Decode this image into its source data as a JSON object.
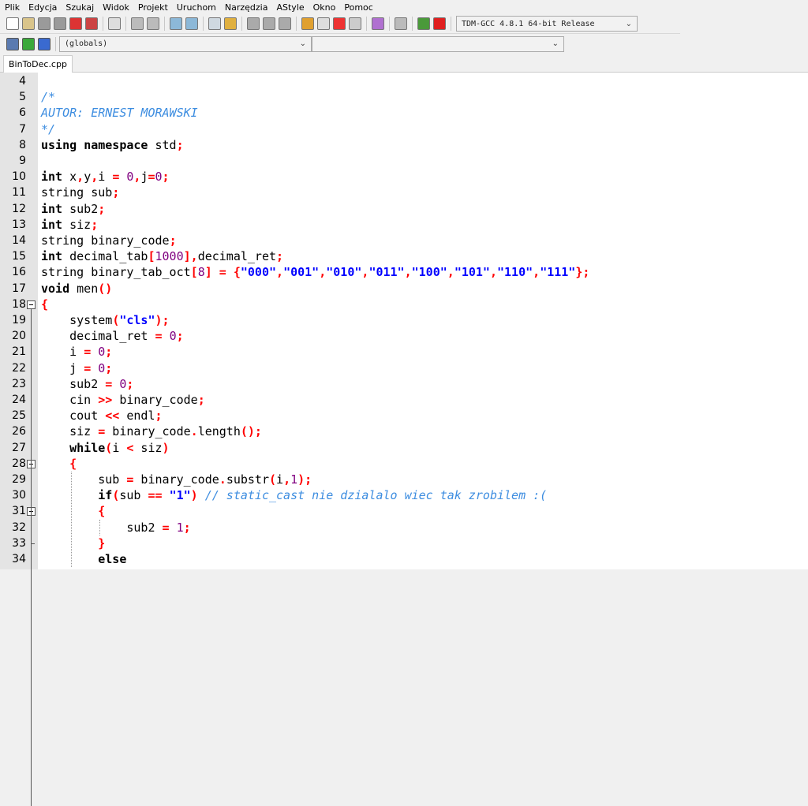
{
  "menu": [
    "Plik",
    "Edycja",
    "Szukaj",
    "Widok",
    "Projekt",
    "Uruchom",
    "Narzędzia",
    "AStyle",
    "Okno",
    "Pomoc"
  ],
  "toolbar1": {
    "icons": [
      "new-file-icon",
      "open-file-icon",
      "save-icon",
      "save-all-icon",
      "close-icon",
      "close-all-icon",
      "print-icon",
      "undo-icon",
      "redo-icon",
      "find-icon",
      "replace-icon",
      "goto-line-icon",
      "bookmark-icon",
      "indent-icon",
      "unindent-icon",
      "toggle-comment-icon",
      "compile-icon",
      "run-icon",
      "compile-run-icon",
      "rebuild-icon",
      "syntax-check-icon",
      "stop-icon",
      "profile-icon",
      "delete-profile-icon"
    ],
    "compiler_select": "TDM-GCC 4.8.1 64-bit Release"
  },
  "toolbar2": {
    "icons": [
      "new-project-icon",
      "add-file-icon",
      "remove-file-icon"
    ],
    "scope_select": "(globals)",
    "member_select": ""
  },
  "tabs": [
    {
      "label": "BinToDec.cpp",
      "active": true
    }
  ],
  "colors": {
    "keyword": "#000000",
    "symbol": "#ff0000",
    "number": "#800080",
    "string": "#0000ff",
    "comment": "#3d8de0",
    "gutter": "#e4e4e4"
  },
  "editor": {
    "lines": [
      {
        "n": "4",
        "t": []
      },
      {
        "n": "5",
        "t": [
          [
            "c",
            "/*"
          ]
        ]
      },
      {
        "n": "6",
        "t": [
          [
            "c",
            "AUTOR: ERNEST MORAWSKI"
          ]
        ]
      },
      {
        "n": "7",
        "t": [
          [
            "c",
            "*/"
          ]
        ]
      },
      {
        "n": "8",
        "t": [
          [
            "k",
            "using"
          ],
          [
            "i",
            " "
          ],
          [
            "k",
            "namespace"
          ],
          [
            "i",
            " std"
          ],
          [
            "s",
            ";"
          ]
        ]
      },
      {
        "n": "9",
        "t": []
      },
      {
        "n": "10",
        "t": [
          [
            "k",
            "int"
          ],
          [
            "i",
            " x"
          ],
          [
            "s",
            ","
          ],
          [
            "i",
            "y"
          ],
          [
            "s",
            ","
          ],
          [
            "i",
            "i "
          ],
          [
            "s",
            "="
          ],
          [
            "i",
            " "
          ],
          [
            "n",
            "0"
          ],
          [
            "s",
            ","
          ],
          [
            "i",
            "j"
          ],
          [
            "s",
            "="
          ],
          [
            "n",
            "0"
          ],
          [
            "s",
            ";"
          ]
        ]
      },
      {
        "n": "11",
        "t": [
          [
            "i",
            "string sub"
          ],
          [
            "s",
            ";"
          ]
        ]
      },
      {
        "n": "12",
        "t": [
          [
            "k",
            "int"
          ],
          [
            "i",
            " sub2"
          ],
          [
            "s",
            ";"
          ]
        ]
      },
      {
        "n": "13",
        "t": [
          [
            "k",
            "int"
          ],
          [
            "i",
            " siz"
          ],
          [
            "s",
            ";"
          ]
        ]
      },
      {
        "n": "14",
        "t": [
          [
            "i",
            "string binary_code"
          ],
          [
            "s",
            ";"
          ]
        ]
      },
      {
        "n": "15",
        "t": [
          [
            "k",
            "int"
          ],
          [
            "i",
            " decimal_tab"
          ],
          [
            "s",
            "["
          ],
          [
            "n",
            "1000"
          ],
          [
            "s",
            "],"
          ],
          [
            "i",
            "decimal_ret"
          ],
          [
            "s",
            ";"
          ]
        ]
      },
      {
        "n": "16",
        "t": [
          [
            "i",
            "string binary_tab_oct"
          ],
          [
            "s",
            "["
          ],
          [
            "n",
            "8"
          ],
          [
            "s",
            "] = {"
          ],
          [
            "str",
            "\"000\""
          ],
          [
            "s",
            ","
          ],
          [
            "str",
            "\"001\""
          ],
          [
            "s",
            ","
          ],
          [
            "str",
            "\"010\""
          ],
          [
            "s",
            ","
          ],
          [
            "str",
            "\"011\""
          ],
          [
            "s",
            ","
          ],
          [
            "str",
            "\"100\""
          ],
          [
            "s",
            ","
          ],
          [
            "str",
            "\"101\""
          ],
          [
            "s",
            ","
          ],
          [
            "str",
            "\"110\""
          ],
          [
            "s",
            ","
          ],
          [
            "str",
            "\"111\""
          ],
          [
            "s",
            "};"
          ]
        ]
      },
      {
        "n": "17",
        "t": [
          [
            "k",
            "void"
          ],
          [
            "i",
            " men"
          ],
          [
            "s",
            "()"
          ]
        ]
      },
      {
        "n": "18",
        "t": [
          [
            "s",
            "{"
          ]
        ]
      },
      {
        "n": "19",
        "t": [
          [
            "i",
            "    system"
          ],
          [
            "s",
            "("
          ],
          [
            "str",
            "\"cls\""
          ],
          [
            "s",
            ");"
          ]
        ]
      },
      {
        "n": "20",
        "t": [
          [
            "i",
            "    decimal_ret "
          ],
          [
            "s",
            "="
          ],
          [
            "i",
            " "
          ],
          [
            "n",
            "0"
          ],
          [
            "s",
            ";"
          ]
        ]
      },
      {
        "n": "21",
        "t": [
          [
            "i",
            "    i "
          ],
          [
            "s",
            "="
          ],
          [
            "i",
            " "
          ],
          [
            "n",
            "0"
          ],
          [
            "s",
            ";"
          ]
        ]
      },
      {
        "n": "22",
        "t": [
          [
            "i",
            "    j "
          ],
          [
            "s",
            "="
          ],
          [
            "i",
            " "
          ],
          [
            "n",
            "0"
          ],
          [
            "s",
            ";"
          ]
        ]
      },
      {
        "n": "23",
        "t": [
          [
            "i",
            "    sub2 "
          ],
          [
            "s",
            "="
          ],
          [
            "i",
            " "
          ],
          [
            "n",
            "0"
          ],
          [
            "s",
            ";"
          ]
        ]
      },
      {
        "n": "24",
        "t": [
          [
            "i",
            "    cin "
          ],
          [
            "s",
            ">>"
          ],
          [
            "i",
            " binary_code"
          ],
          [
            "s",
            ";"
          ]
        ]
      },
      {
        "n": "25",
        "t": [
          [
            "i",
            "    cout "
          ],
          [
            "s",
            "<<"
          ],
          [
            "i",
            " endl"
          ],
          [
            "s",
            ";"
          ]
        ]
      },
      {
        "n": "26",
        "t": [
          [
            "i",
            "    siz "
          ],
          [
            "s",
            "="
          ],
          [
            "i",
            " binary_code"
          ],
          [
            "s",
            "."
          ],
          [
            "i",
            "length"
          ],
          [
            "s",
            "();"
          ]
        ]
      },
      {
        "n": "27",
        "t": [
          [
            "i",
            "    "
          ],
          [
            "k",
            "while"
          ],
          [
            "s",
            "("
          ],
          [
            "i",
            "i "
          ],
          [
            "s",
            "<"
          ],
          [
            "i",
            " siz"
          ],
          [
            "s",
            ")"
          ]
        ]
      },
      {
        "n": "28",
        "t": [
          [
            "i",
            "    "
          ],
          [
            "s",
            "{"
          ]
        ]
      },
      {
        "n": "29",
        "t": [
          [
            "i",
            "        sub "
          ],
          [
            "s",
            "="
          ],
          [
            "i",
            " binary_code"
          ],
          [
            "s",
            "."
          ],
          [
            "i",
            "substr"
          ],
          [
            "s",
            "("
          ],
          [
            "i",
            "i"
          ],
          [
            "s",
            ","
          ],
          [
            "n",
            "1"
          ],
          [
            "s",
            ");"
          ]
        ]
      },
      {
        "n": "30",
        "t": [
          [
            "i",
            "        "
          ],
          [
            "k",
            "if"
          ],
          [
            "s",
            "("
          ],
          [
            "i",
            "sub "
          ],
          [
            "s",
            "=="
          ],
          [
            "i",
            " "
          ],
          [
            "str",
            "\"1\""
          ],
          [
            "s",
            ")"
          ],
          [
            "i",
            " "
          ],
          [
            "c",
            "// static_cast nie dzialalo wiec tak zrobilem :("
          ]
        ]
      },
      {
        "n": "31",
        "t": [
          [
            "i",
            "        "
          ],
          [
            "s",
            "{"
          ]
        ]
      },
      {
        "n": "32",
        "t": [
          [
            "i",
            "            sub2 "
          ],
          [
            "s",
            "="
          ],
          [
            "i",
            " "
          ],
          [
            "n",
            "1"
          ],
          [
            "s",
            ";"
          ]
        ]
      },
      {
        "n": "33",
        "t": [
          [
            "i",
            "        "
          ],
          [
            "s",
            "}"
          ]
        ]
      },
      {
        "n": "34",
        "t": [
          [
            "i",
            "        "
          ],
          [
            "k",
            "else"
          ]
        ]
      }
    ]
  }
}
